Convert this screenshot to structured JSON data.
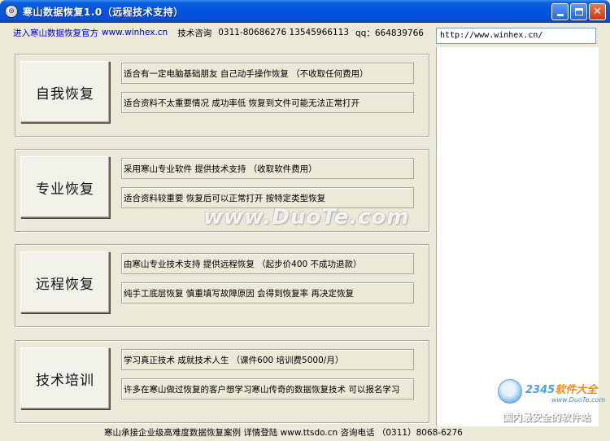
{
  "window": {
    "title": "寒山数据恢复1.0（远程技术支持）",
    "minimize_glyph": "_",
    "maximize_glyph": "□",
    "close_glyph": "✕"
  },
  "infobar": {
    "entry_link": "进入寒山数据恢复官方",
    "entry_url": "www.winhex.cn",
    "contact_label": "技术咨询",
    "phones": "0311-80686276  13545966113",
    "qq": "qq：664839766"
  },
  "browser": {
    "url": "http://www.winhex.cn/"
  },
  "sections": [
    {
      "button": "自我恢复",
      "line1": "适合有一定电脑基础朋友  自己动手操作恢复     （不收取任何费用）",
      "line2": "适合资料不太重要情况    成功率低    恢复到文件可能无法正常打开"
    },
    {
      "button": "专业恢复",
      "line1": "采用寒山专业软件  提供技术支持    （收取软件费用）",
      "line2": "适合资料较重要  恢复后可以正常打开  按特定类型恢复"
    },
    {
      "button": "远程恢复",
      "line1": "由寒山专业技术支持  提供远程恢复    （起步价400  不成功退款）",
      "line2": "纯手工底层恢复    慎重填写故障原因  会得到恢复率  再决定恢复"
    },
    {
      "button": "技术培训",
      "line1": "学习真正技术  成就技术人生    （课件600  培训费5000/月）",
      "line2": "许多在寒山做过恢复的客户想学习寒山传奇的数据恢复技术  可以报名学习"
    }
  ],
  "status": {
    "text": "寒山承接企业级高难度数据恢复案例  详情登陆  www.ttsdo.cn  咨询电话  （0311）8068-6276"
  },
  "watermarks": {
    "duote": "www.DuoTe.com",
    "brand_2345_prefix": "2345",
    "brand_2345_suffix": "软件大全",
    "brand_2345_url": "www.DuoTe.com",
    "slogan": "国内最安全的软件站"
  },
  "icons": {
    "app": "app-logo-icon",
    "minimize": "minimize-icon",
    "maximize": "maximize-icon",
    "close": "close-icon"
  },
  "colors": {
    "titlebar": "#0054e3",
    "window_bg": "#ece9d8",
    "link": "#0000cc"
  }
}
